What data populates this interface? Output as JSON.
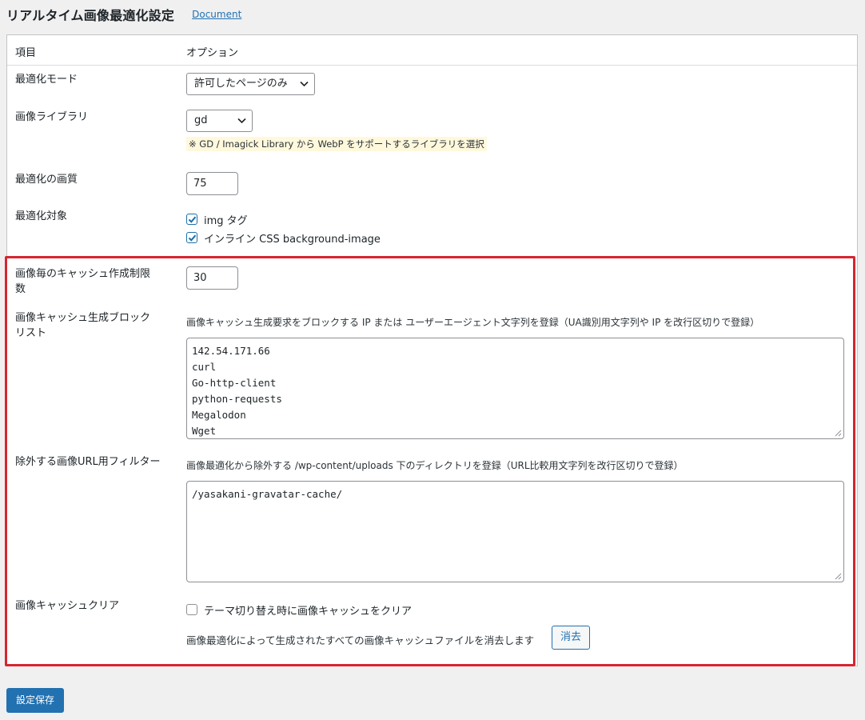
{
  "header": {
    "title": "リアルタイム画像最適化設定",
    "document_link": "Document"
  },
  "table_header": {
    "item": "項目",
    "option": "オプション"
  },
  "mode": {
    "label": "最適化モード",
    "selected": "許可したページのみ"
  },
  "library": {
    "label": "画像ライブラリ",
    "selected": "gd",
    "note": "※ GD / Imagick Library から WebP をサポートするライブラリを選択"
  },
  "quality": {
    "label": "最適化の画質",
    "value": "75"
  },
  "targets": {
    "label": "最適化対象",
    "items": [
      {
        "label": "img タグ",
        "checked": true
      },
      {
        "label": "インライン CSS background-image",
        "checked": true
      }
    ]
  },
  "cache_limit": {
    "label_line1": "画像毎のキャッシュ作成制限",
    "label_line2": "数",
    "value": "30"
  },
  "blocklist": {
    "label_line1": "画像キャッシュ生成ブロック",
    "label_line2": "リスト",
    "description": "画像キャッシュ生成要求をブロックする IP または ユーザーエージェント文字列を登録（UA識別用文字列や IP を改行区切りで登録）",
    "lines": [
      "142.54.171.66",
      "curl",
      "Go-http-client",
      "python-requests",
      "Megalodon",
      "Wget"
    ]
  },
  "exclude_filter": {
    "label": "除外する画像URL用フィルター",
    "description": "画像最適化から除外する /wp-content/uploads 下のディレクトリを登録（URL比較用文字列を改行区切りで登録）",
    "lines": [
      "/yasakani-gravatar-cache/"
    ]
  },
  "cache_clear": {
    "label": "画像キャッシュクリア",
    "checkbox_label": "テーマ切り替え時に画像キャッシュをクリア",
    "checked": false,
    "description": "画像最適化によって生成されたすべての画像キャッシュファイルを消去します",
    "button": "消去"
  },
  "save_button": "設定保存",
  "colors": {
    "primary": "#2271b1",
    "highlight": "#d6262f",
    "note_bg": "#fff8dc"
  }
}
